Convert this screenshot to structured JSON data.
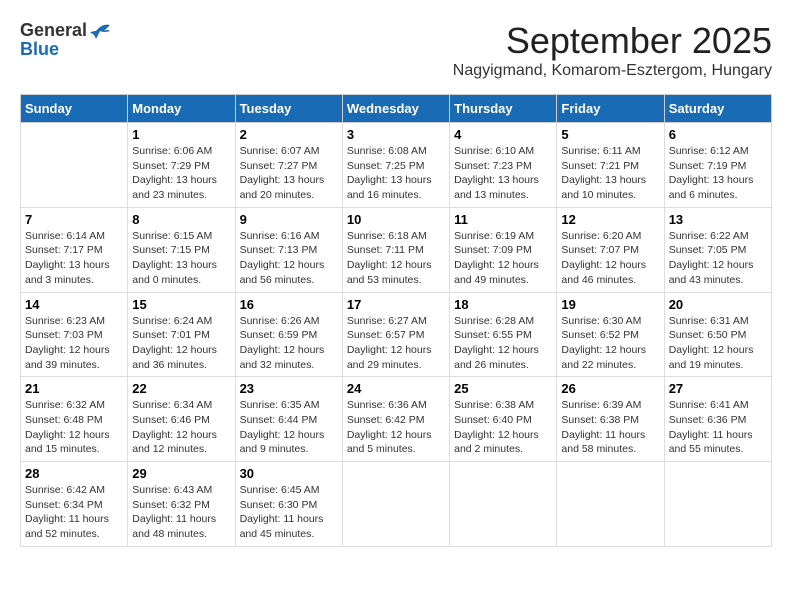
{
  "header": {
    "logo_general": "General",
    "logo_blue": "Blue",
    "month_title": "September 2025",
    "subtitle": "Nagyigmand, Komarom-Esztergom, Hungary"
  },
  "days_of_week": [
    "Sunday",
    "Monday",
    "Tuesday",
    "Wednesday",
    "Thursday",
    "Friday",
    "Saturday"
  ],
  "weeks": [
    [
      {
        "day": "",
        "info": ""
      },
      {
        "day": "1",
        "info": "Sunrise: 6:06 AM\nSunset: 7:29 PM\nDaylight: 13 hours\nand 23 minutes."
      },
      {
        "day": "2",
        "info": "Sunrise: 6:07 AM\nSunset: 7:27 PM\nDaylight: 13 hours\nand 20 minutes."
      },
      {
        "day": "3",
        "info": "Sunrise: 6:08 AM\nSunset: 7:25 PM\nDaylight: 13 hours\nand 16 minutes."
      },
      {
        "day": "4",
        "info": "Sunrise: 6:10 AM\nSunset: 7:23 PM\nDaylight: 13 hours\nand 13 minutes."
      },
      {
        "day": "5",
        "info": "Sunrise: 6:11 AM\nSunset: 7:21 PM\nDaylight: 13 hours\nand 10 minutes."
      },
      {
        "day": "6",
        "info": "Sunrise: 6:12 AM\nSunset: 7:19 PM\nDaylight: 13 hours\nand 6 minutes."
      }
    ],
    [
      {
        "day": "7",
        "info": "Sunrise: 6:14 AM\nSunset: 7:17 PM\nDaylight: 13 hours\nand 3 minutes."
      },
      {
        "day": "8",
        "info": "Sunrise: 6:15 AM\nSunset: 7:15 PM\nDaylight: 13 hours\nand 0 minutes."
      },
      {
        "day": "9",
        "info": "Sunrise: 6:16 AM\nSunset: 7:13 PM\nDaylight: 12 hours\nand 56 minutes."
      },
      {
        "day": "10",
        "info": "Sunrise: 6:18 AM\nSunset: 7:11 PM\nDaylight: 12 hours\nand 53 minutes."
      },
      {
        "day": "11",
        "info": "Sunrise: 6:19 AM\nSunset: 7:09 PM\nDaylight: 12 hours\nand 49 minutes."
      },
      {
        "day": "12",
        "info": "Sunrise: 6:20 AM\nSunset: 7:07 PM\nDaylight: 12 hours\nand 46 minutes."
      },
      {
        "day": "13",
        "info": "Sunrise: 6:22 AM\nSunset: 7:05 PM\nDaylight: 12 hours\nand 43 minutes."
      }
    ],
    [
      {
        "day": "14",
        "info": "Sunrise: 6:23 AM\nSunset: 7:03 PM\nDaylight: 12 hours\nand 39 minutes."
      },
      {
        "day": "15",
        "info": "Sunrise: 6:24 AM\nSunset: 7:01 PM\nDaylight: 12 hours\nand 36 minutes."
      },
      {
        "day": "16",
        "info": "Sunrise: 6:26 AM\nSunset: 6:59 PM\nDaylight: 12 hours\nand 32 minutes."
      },
      {
        "day": "17",
        "info": "Sunrise: 6:27 AM\nSunset: 6:57 PM\nDaylight: 12 hours\nand 29 minutes."
      },
      {
        "day": "18",
        "info": "Sunrise: 6:28 AM\nSunset: 6:55 PM\nDaylight: 12 hours\nand 26 minutes."
      },
      {
        "day": "19",
        "info": "Sunrise: 6:30 AM\nSunset: 6:52 PM\nDaylight: 12 hours\nand 22 minutes."
      },
      {
        "day": "20",
        "info": "Sunrise: 6:31 AM\nSunset: 6:50 PM\nDaylight: 12 hours\nand 19 minutes."
      }
    ],
    [
      {
        "day": "21",
        "info": "Sunrise: 6:32 AM\nSunset: 6:48 PM\nDaylight: 12 hours\nand 15 minutes."
      },
      {
        "day": "22",
        "info": "Sunrise: 6:34 AM\nSunset: 6:46 PM\nDaylight: 12 hours\nand 12 minutes."
      },
      {
        "day": "23",
        "info": "Sunrise: 6:35 AM\nSunset: 6:44 PM\nDaylight: 12 hours\nand 9 minutes."
      },
      {
        "day": "24",
        "info": "Sunrise: 6:36 AM\nSunset: 6:42 PM\nDaylight: 12 hours\nand 5 minutes."
      },
      {
        "day": "25",
        "info": "Sunrise: 6:38 AM\nSunset: 6:40 PM\nDaylight: 12 hours\nand 2 minutes."
      },
      {
        "day": "26",
        "info": "Sunrise: 6:39 AM\nSunset: 6:38 PM\nDaylight: 11 hours\nand 58 minutes."
      },
      {
        "day": "27",
        "info": "Sunrise: 6:41 AM\nSunset: 6:36 PM\nDaylight: 11 hours\nand 55 minutes."
      }
    ],
    [
      {
        "day": "28",
        "info": "Sunrise: 6:42 AM\nSunset: 6:34 PM\nDaylight: 11 hours\nand 52 minutes."
      },
      {
        "day": "29",
        "info": "Sunrise: 6:43 AM\nSunset: 6:32 PM\nDaylight: 11 hours\nand 48 minutes."
      },
      {
        "day": "30",
        "info": "Sunrise: 6:45 AM\nSunset: 6:30 PM\nDaylight: 11 hours\nand 45 minutes."
      },
      {
        "day": "",
        "info": ""
      },
      {
        "day": "",
        "info": ""
      },
      {
        "day": "",
        "info": ""
      },
      {
        "day": "",
        "info": ""
      }
    ]
  ]
}
